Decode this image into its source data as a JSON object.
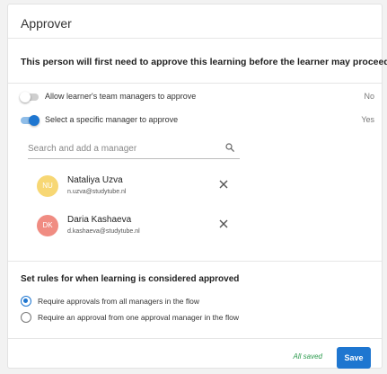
{
  "header": {
    "title": "Approver"
  },
  "intro": "This person will first need to approve this learning before the learner may proceed",
  "toggles": [
    {
      "label": "Allow learner's team managers to approve",
      "value": "No",
      "enabled": false
    },
    {
      "label": "Select a specific manager to approve",
      "value": "Yes",
      "enabled": true
    }
  ],
  "search": {
    "placeholder": "Search and add a manager",
    "value": "",
    "icon": "search-icon"
  },
  "managers": [
    {
      "initials": "NU",
      "name": "Nataliya Uzva",
      "email": "n.uzva@studytube.nl",
      "avatar_color": "#f7d774"
    },
    {
      "initials": "DK",
      "name": "Daria Kashaeva",
      "email": "d.kashaeva@studytube.nl",
      "avatar_color": "#f08c82"
    }
  ],
  "rules": {
    "title": "Set rules for when learning is considered approved",
    "options": [
      {
        "label": "Require approvals from all managers in the flow",
        "selected": true
      },
      {
        "label": "Require an approval from one approval manager in the flow",
        "selected": false
      }
    ]
  },
  "footer": {
    "status": "All saved",
    "save_label": "Save"
  },
  "colors": {
    "accent": "#1e76d0",
    "saved_text": "#2e9b4f"
  }
}
